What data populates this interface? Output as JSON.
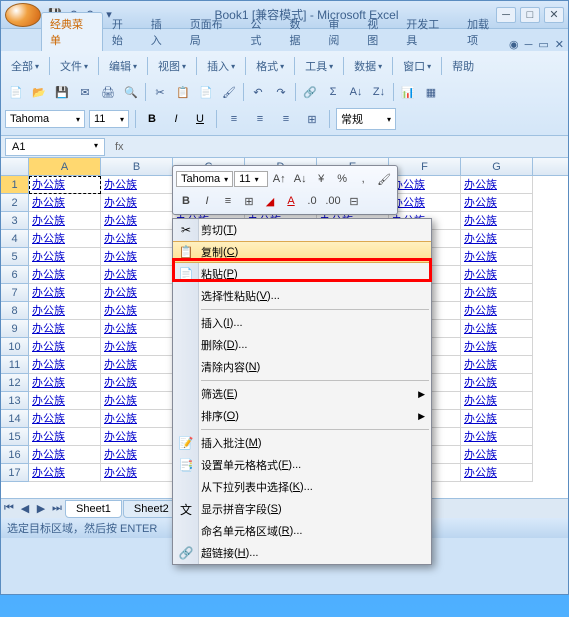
{
  "title": "Book1 [兼容模式] - Microsoft Excel",
  "qat": {
    "save": "💾",
    "undo": "↶",
    "redo": "↷"
  },
  "tabs": {
    "classic": "经典菜单",
    "home": "开始",
    "insert": "插入",
    "layout": "页面布局",
    "formula": "公式",
    "data": "数据",
    "review": "审阅",
    "view": "视图",
    "dev": "开发工具",
    "addin": "加载项"
  },
  "menus": {
    "all": "全部",
    "file": "文件",
    "edit": "编辑",
    "view": "视图",
    "insert": "插入",
    "format": "格式",
    "tools": "工具",
    "data": "数据",
    "window": "窗口",
    "help": "帮助"
  },
  "format": {
    "font": "Tahoma",
    "size": "11",
    "b": "B",
    "i": "I",
    "u": "U",
    "normal": "常规"
  },
  "namebox": "A1",
  "cols": [
    "A",
    "B",
    "C",
    "D",
    "E",
    "F",
    "G"
  ],
  "cell_text": "办公族",
  "sheets": {
    "s1": "Sheet1",
    "s2": "Sheet2"
  },
  "status": "选定目标区域，然后按 ENTER",
  "mini": {
    "font": "Tahoma",
    "size": "11",
    "b": "B",
    "i": "I",
    "a": "A"
  },
  "ctx": {
    "cut": "剪切",
    "cut_k": "T",
    "copy": "复制",
    "copy_k": "C",
    "paste": "粘贴",
    "paste_k": "P",
    "pspecial": "选择性粘贴",
    "pspecial_k": "V",
    "ins": "插入",
    "ins_k": "I",
    "del": "删除",
    "del_k": "D",
    "clear": "清除内容",
    "clear_k": "N",
    "filter": "筛选",
    "filter_k": "E",
    "sort": "排序",
    "sort_k": "O",
    "comment": "插入批注",
    "comment_k": "M",
    "cellfmt": "设置单元格格式",
    "cellfmt_k": "F",
    "ddlist": "从下拉列表中选择",
    "ddlist_k": "K",
    "pinyin": "显示拼音字段",
    "pinyin_k": "S",
    "namerange": "命名单元格区域",
    "namerange_k": "R",
    "hyperlink": "超链接",
    "hyperlink_k": "H"
  }
}
